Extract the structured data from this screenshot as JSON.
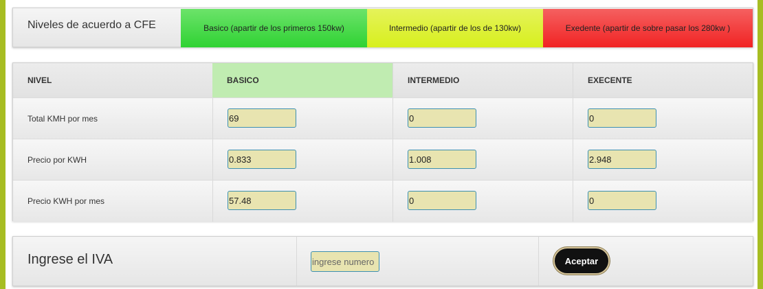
{
  "levels": {
    "title": "Niveles de acuerdo a CFE",
    "basic": "Basico (apartir de los primeros 150kw)",
    "intermediate": "Intermedio (apartir de los de 130kw)",
    "excess": "Exedente (apartir de sobre pasar los 280kw )",
    "colors": {
      "basic": "#3bd63b",
      "intermediate": "#dcf128",
      "excess": "#f33333"
    }
  },
  "table": {
    "headers": [
      "NIVEL",
      "BASICO",
      "INTERMEDIO",
      "EXECENTE"
    ],
    "rows": [
      {
        "label": "Total KMH por mes",
        "values": [
          "69",
          "0",
          "0"
        ]
      },
      {
        "label": "Precio por KWH",
        "values": [
          "0.833",
          "1.008",
          "2.948"
        ]
      },
      {
        "label": "Precio KWH por mes",
        "values": [
          "57.48",
          "0",
          "0"
        ]
      }
    ]
  },
  "iva": {
    "label": "Ingrese el IVA",
    "placeholder": "ingrese numero",
    "button": "Aceptar"
  }
}
